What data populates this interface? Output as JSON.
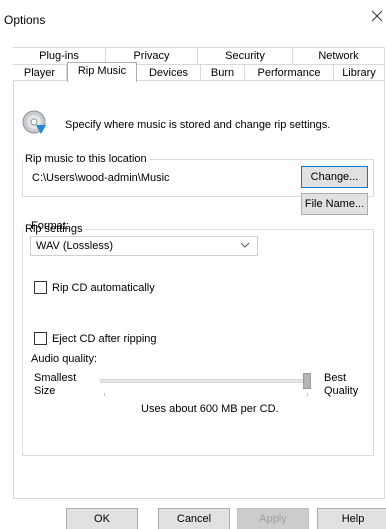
{
  "window": {
    "title": "Options"
  },
  "tabs": {
    "top": [
      "Plug-ins",
      "Privacy",
      "Security",
      "Network"
    ],
    "bottom": [
      "Player",
      "Rip Music",
      "Devices",
      "Burn",
      "Performance",
      "Library"
    ],
    "selected": "Rip Music"
  },
  "header": {
    "icon": "cd-rip-icon",
    "text": "Specify where music is stored and change rip settings."
  },
  "location_group": {
    "legend": "Rip music to this location",
    "path": "C:\\Users\\wood-admin\\Music",
    "change_button": "Change...",
    "filename_button": "File Name..."
  },
  "settings_group": {
    "legend": "Rip settings",
    "format_label": "Format:",
    "format_value": "WAV (Lossless)",
    "rip_cd_auto_label": "Rip CD automatically",
    "rip_cd_auto_checked": false,
    "eject_label": "Eject CD after ripping",
    "eject_checked": false,
    "audio_quality_label": "Audio quality:",
    "smallest_label": "Smallest",
    "size_label": "Size",
    "best_label": "Best",
    "quality_label": "Quality",
    "usage_text": "Uses about 600 MB per CD.",
    "quality_level": 1.0
  },
  "footer": {
    "ok": "OK",
    "cancel": "Cancel",
    "apply": "Apply",
    "help": "Help"
  },
  "colors": {
    "focus_border": "#0078d7",
    "button_bg": "#e1e1e1"
  }
}
